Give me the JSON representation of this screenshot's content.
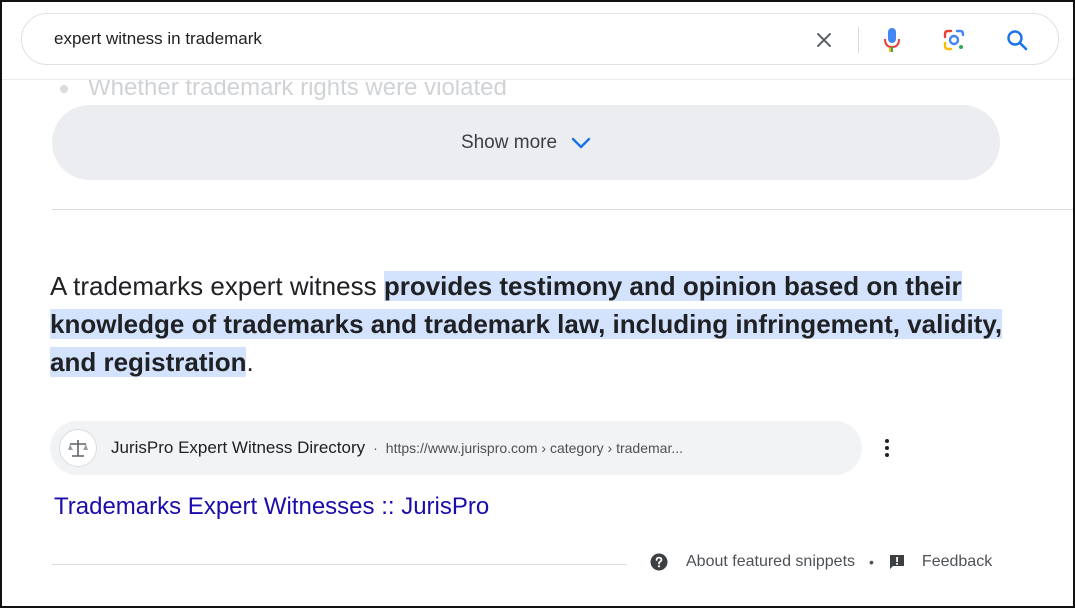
{
  "search": {
    "query": "expert witness in trademark"
  },
  "faded_bullet": "Whether trademark rights were violated",
  "show_more": {
    "label": "Show more"
  },
  "snippet": {
    "answer_plain": "A trademarks expert witness ",
    "answer_highlight": "provides testimony and opinion based on their knowledge of trademarks and trademark law, including infringement, validity, and registration",
    "answer_end": "."
  },
  "source": {
    "name": "JurisPro Expert Witness Directory",
    "separator": "·",
    "url": "https://www.jurispro.com › category › trademar..."
  },
  "result": {
    "title": "Trademarks Expert Witnesses :: JurisPro"
  },
  "footer": {
    "about_label": "About featured snippets",
    "separator": "•",
    "feedback_label": "Feedback"
  },
  "colors": {
    "link": "#1a0dab",
    "highlight": "#d3e3fd",
    "accent_blue": "#1a73e8"
  }
}
